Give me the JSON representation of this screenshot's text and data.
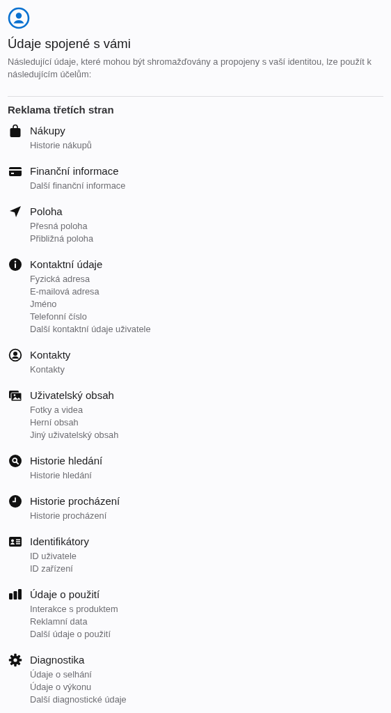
{
  "header": {
    "title": "Údaje spojené s vámi",
    "description": "Následující údaje, které mohou být shromažďovány a propojeny s vaší identitou, lze použít k následujícím účelům:"
  },
  "section": {
    "title": "Reklama třetích stran",
    "categories": [
      {
        "title": "Nákupy",
        "items": [
          "Historie nákupů"
        ]
      },
      {
        "title": "Finanční informace",
        "items": [
          "Další finanční informace"
        ]
      },
      {
        "title": "Poloha",
        "items": [
          "Přesná poloha",
          "Přibližná poloha"
        ]
      },
      {
        "title": "Kontaktní údaje",
        "items": [
          "Fyzická adresa",
          "E-mailová adresa",
          "Jméno",
          "Telefonní číslo",
          "Další kontaktní údaje uživatele"
        ]
      },
      {
        "title": "Kontakty",
        "items": [
          "Kontakty"
        ]
      },
      {
        "title": "Uživatelský obsah",
        "items": [
          "Fotky a videa",
          "Herní obsah",
          "Jiný uživatelský obsah"
        ]
      },
      {
        "title": "Historie hledání",
        "items": [
          "Historie hledání"
        ]
      },
      {
        "title": "Historie procházení",
        "items": [
          "Historie procházení"
        ]
      },
      {
        "title": "Identifikátory",
        "items": [
          "ID uživatele",
          "ID zařízení"
        ]
      },
      {
        "title": "Údaje o použití",
        "items": [
          "Interakce s produktem",
          "Reklamní data",
          "Další údaje o použití"
        ]
      },
      {
        "title": "Diagnostika",
        "items": [
          "Údaje o selhání",
          "Údaje o výkonu",
          "Další diagnostické údaje"
        ]
      }
    ]
  }
}
